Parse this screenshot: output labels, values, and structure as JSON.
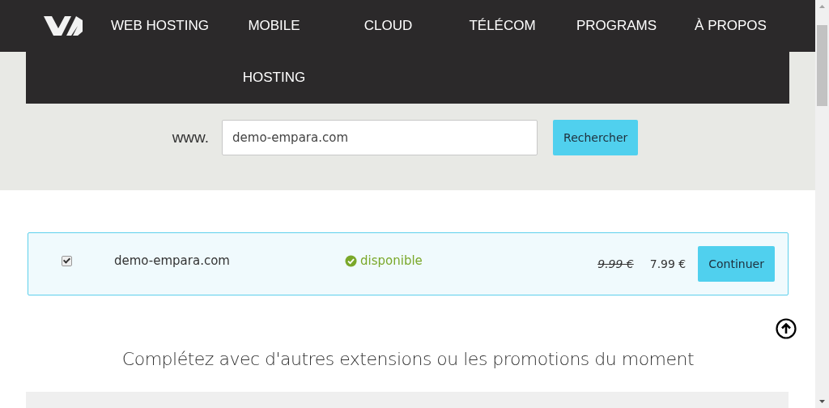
{
  "nav": {
    "items": [
      {
        "label": "WEB HOSTING"
      },
      {
        "label": "MOBILE HOSTING"
      },
      {
        "label": "CLOUD"
      },
      {
        "label": "TÉLÉCOM"
      },
      {
        "label": "PROGRAMS"
      },
      {
        "label": "À PROPOS"
      }
    ]
  },
  "search": {
    "prefix": "www.",
    "value": "demo-empara.com",
    "button": "Rechercher"
  },
  "result": {
    "checked": true,
    "domain": "demo-empara.com",
    "status": "disponible",
    "old_price": "9.99 €",
    "price": "7.99 €",
    "button": "Continuer"
  },
  "promo_heading": "Complétez avec d'autres extensions ou les promotions du moment"
}
